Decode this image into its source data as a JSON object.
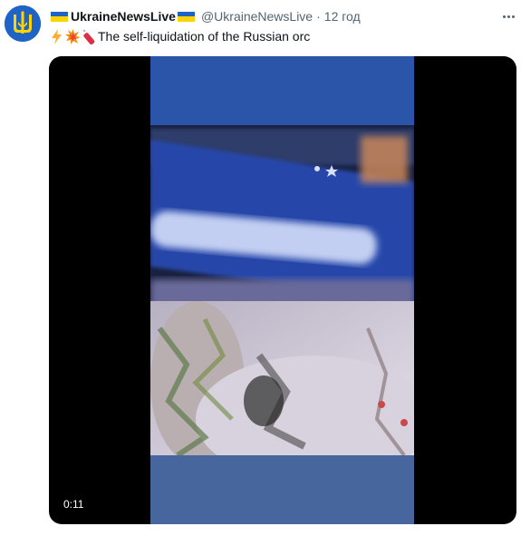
{
  "author": {
    "display_name": "UkraineNewsLive",
    "handle": "@UkraineNewsLive",
    "separator": "·",
    "timestamp": "12 год",
    "avatar_icon": "trident-icon"
  },
  "tweet": {
    "text": "The self-liquidation of the Russian orc",
    "emojis": [
      "lightning-icon",
      "collision-icon",
      "firecracker-icon"
    ]
  },
  "media": {
    "type": "video",
    "duration": "0:11"
  },
  "icons": {
    "more": "more-options-icon",
    "flag": "ukraine-flag-icon"
  },
  "colors": {
    "flag_blue": "#1f63c7",
    "flag_yellow": "#ffd400",
    "secondary_text": "#536471",
    "primary_text": "#0f1419"
  }
}
